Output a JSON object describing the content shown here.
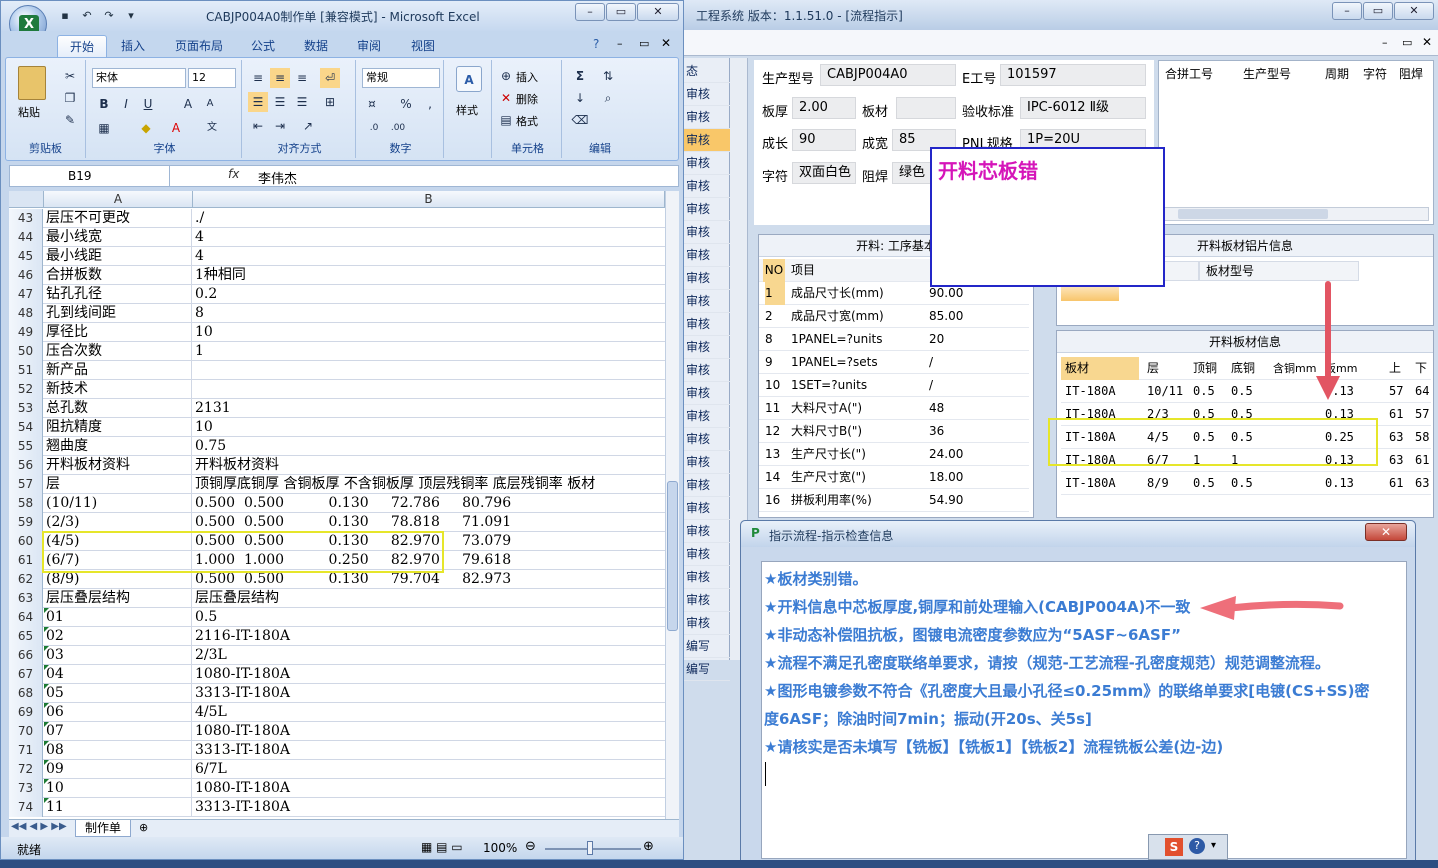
{
  "excel": {
    "title": "CABJP004A0制作单 [兼容模式] - Microsoft Excel",
    "tabs": [
      "开始",
      "插入",
      "页面布局",
      "公式",
      "数据",
      "审阅",
      "视图"
    ],
    "font_name": "宋体",
    "font_size": "12",
    "number_format": "常规",
    "groups": {
      "clipboard": "剪贴板",
      "font": "字体",
      "align": "对齐方式",
      "number": "数字",
      "cells": "单元格",
      "edit": "编辑"
    },
    "paste_label": "粘贴",
    "style_label": "样式",
    "insert_label": "插入",
    "delete_label": "删除",
    "format_label": "格式",
    "name_box": "B19",
    "fx": "fx",
    "formula_value": "李伟杰",
    "col_a": "A",
    "col_b": "B",
    "rows": [
      {
        "n": "43",
        "a": "层压不可更改",
        "b": "./",
        "t": false
      },
      {
        "n": "44",
        "a": "最小线宽",
        "b": "4",
        "t": false
      },
      {
        "n": "45",
        "a": "最小线距",
        "b": "4",
        "t": false
      },
      {
        "n": "46",
        "a": "合拼板数",
        "b": "1种相同",
        "t": false
      },
      {
        "n": "47",
        "a": "钻孔孔径",
        "b": "0.2",
        "t": false
      },
      {
        "n": "48",
        "a": "孔到线间距",
        "b": "8",
        "t": false
      },
      {
        "n": "49",
        "a": "厚径比",
        "b": "10",
        "t": false
      },
      {
        "n": "50",
        "a": "压合次数",
        "b": "1",
        "t": false
      },
      {
        "n": "51",
        "a": "新产品",
        "b": "",
        "t": false
      },
      {
        "n": "52",
        "a": "新技术",
        "b": "",
        "t": false
      },
      {
        "n": "53",
        "a": "总孔数",
        "b": "2131",
        "t": false
      },
      {
        "n": "54",
        "a": "阻抗精度",
        "b": "10",
        "t": false
      },
      {
        "n": "55",
        "a": "翘曲度",
        "b": "0.75",
        "t": false
      },
      {
        "n": "56",
        "a": "开料板材资料",
        "b": "开料板材资料",
        "t": false
      },
      {
        "n": "57",
        "a": "层",
        "b": "顶铜厚底铜厚 含铜板厚 不含铜板厚 顶层残铜率 底层残铜率 板材",
        "t": false
      },
      {
        "n": "58",
        "a": "(10/11)",
        "b": "0.500  0.500          0.130     72.786     80.796",
        "t": false
      },
      {
        "n": "59",
        "a": "(2/3)",
        "b": "0.500  0.500          0.130     78.818     71.091",
        "t": false
      },
      {
        "n": "60",
        "a": "(4/5)",
        "b": "0.500  0.500          0.130     82.970     73.079",
        "t": false
      },
      {
        "n": "61",
        "a": "(6/7)",
        "b": "1.000  1.000          0.250     82.970     79.618",
        "t": false
      },
      {
        "n": "62",
        "a": "(8/9)",
        "b": "0.500  0.500          0.130     79.704     82.973",
        "t": false
      },
      {
        "n": "63",
        "a": "层压叠层结构",
        "b": "层压叠层结构",
        "t": false
      },
      {
        "n": "64",
        "a": "01",
        "b": "0.5",
        "t": true
      },
      {
        "n": "65",
        "a": "02",
        "b": "2116-IT-180A",
        "t": true
      },
      {
        "n": "66",
        "a": "03",
        "b": "2/3L",
        "t": true
      },
      {
        "n": "67",
        "a": "04",
        "b": "1080-IT-180A",
        "t": true
      },
      {
        "n": "68",
        "a": "05",
        "b": "3313-IT-180A",
        "t": true
      },
      {
        "n": "69",
        "a": "06",
        "b": "4/5L",
        "t": true
      },
      {
        "n": "70",
        "a": "07",
        "b": "1080-IT-180A",
        "t": true
      },
      {
        "n": "71",
        "a": "08",
        "b": "3313-IT-180A",
        "t": true
      },
      {
        "n": "72",
        "a": "09",
        "b": "6/7L",
        "t": true
      },
      {
        "n": "73",
        "a": "10",
        "b": "1080-IT-180A",
        "t": true
      },
      {
        "n": "74",
        "a": "11",
        "b": "3313-IT-180A",
        "t": true
      }
    ],
    "sheet_tab": "制作单",
    "status": "就绪",
    "zoom": "100%"
  },
  "eng": {
    "title": "工程系统  版本：1.1.51.0 - [流程指示]",
    "side_header": "态",
    "side_items": [
      "审核",
      "审核",
      "审核",
      "审核",
      "审核",
      "审核",
      "审核",
      "审核",
      "审核",
      "审核",
      "审核",
      "审核",
      "审核",
      "审核",
      "审核",
      "审核",
      "审核",
      "审核",
      "审核",
      "审核",
      "审核",
      "审核",
      "审核",
      "审核",
      "编写",
      "编写"
    ],
    "info": {
      "model_label": "生产型号",
      "model": "CABJP004A0",
      "eng_label": "E工号",
      "eng": "101597",
      "thick_label": "板厚",
      "thick": "2.00",
      "mat_label": "板材",
      "mat": "",
      "std_label": "验收标准",
      "std": "IPC-6012 Ⅱ级",
      "len_label": "成长",
      "len": "90",
      "wid_label": "成宽",
      "wid": "85",
      "pnl_label": "PNL规格",
      "pnl": "1P=20U",
      "char_label": "字符",
      "char": "双面白色",
      "mask_label": "阻焊",
      "mask": "绿色"
    },
    "right_headers": [
      "合拼工号",
      "生产型号",
      "周期",
      "字符",
      "阻焊"
    ],
    "kl_title": "开料: 工序基本",
    "kl_headers": [
      "NO",
      "项目"
    ],
    "kl_rows": [
      {
        "no": "1",
        "item": "成品尺寸长(mm)",
        "val": "90.00"
      },
      {
        "no": "2",
        "item": "成品尺寸宽(mm)",
        "val": "85.00"
      },
      {
        "no": "8",
        "item": "1PANEL=?units",
        "val": "20"
      },
      {
        "no": "9",
        "item": "1PANEL=?sets",
        "val": "/"
      },
      {
        "no": "10",
        "item": "1SET=?units",
        "val": "/"
      },
      {
        "no": "11",
        "item": "大料尺寸A(\")",
        "val": "48"
      },
      {
        "no": "12",
        "item": "大料尺寸B(\")",
        "val": "36"
      },
      {
        "no": "13",
        "item": "生产尺寸长(\")",
        "val": "24.00"
      },
      {
        "no": "14",
        "item": "生产尺寸宽(\")",
        "val": "18.00"
      },
      {
        "no": "16",
        "item": "拼板利用率(%)",
        "val": "54.90"
      }
    ],
    "lp_title": "开料板材铝片信息",
    "lp_header": "板材型号",
    "mat_title": "开料板材信息",
    "mat_headers": [
      "板材",
      "层",
      "顶铜",
      "底铜",
      "含铜mm",
      "板mm",
      "上",
      "下"
    ],
    "mat_rows": [
      {
        "m": "IT-180A",
        "l": "10/11",
        "t": "0.5",
        "b": "0.5",
        "c": "",
        "th": "0.13",
        "u": "57",
        "d": "64"
      },
      {
        "m": "IT-180A",
        "l": "2/3",
        "t": "0.5",
        "b": "0.5",
        "c": "",
        "th": "0.13",
        "u": "61",
        "d": "57"
      },
      {
        "m": "IT-180A",
        "l": "4/5",
        "t": "0.5",
        "b": "0.5",
        "c": "",
        "th": "0.25",
        "u": "63",
        "d": "58"
      },
      {
        "m": "IT-180A",
        "l": "6/7",
        "t": "1",
        "b": "1",
        "c": "",
        "th": "0.13",
        "u": "63",
        "d": "61"
      },
      {
        "m": "IT-180A",
        "l": "8/9",
        "t": "0.5",
        "b": "0.5",
        "c": "",
        "th": "0.13",
        "u": "61",
        "d": "63"
      }
    ],
    "annotation": "开料芯板错"
  },
  "dialog": {
    "title": "指示流程-指示检查信息",
    "messages": [
      "★板材类别错。",
      "★开料信息中芯板厚度,铜厚和前处理输入(CABJP004A)不一致",
      "★非动态补偿阻抗板，图镀电流密度参数应为“5ASF~6ASF”",
      "★流程不满足孔密度联络单要求，请按（规范-工艺流程-孔密度规范）规范调整流程。",
      "★图形电镀参数不符合《孔密度大且最小孔径≤0.25mm》的联络单要求[电镀(CS+SS)密",
      "度6ASF；除油时间7min；振动(开20s、关5s]",
      "★请核实是否未填写【铣板】【铣板1】【铣板2】流程铣板公差(边-边)"
    ]
  }
}
